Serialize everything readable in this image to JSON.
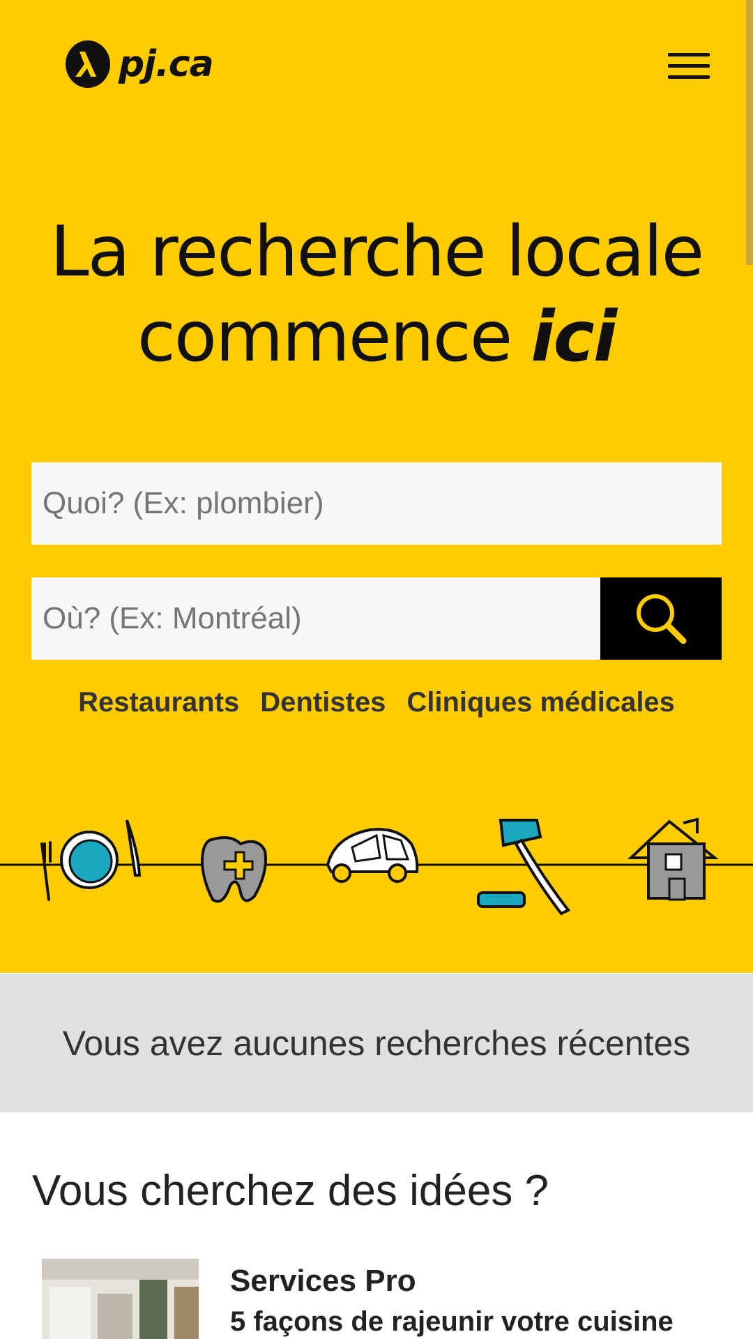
{
  "header": {
    "logo_text": "pj.ca"
  },
  "hero": {
    "headline_line1": "La recherche locale",
    "headline_line2": "commence",
    "headline_emphasis": "ici"
  },
  "search": {
    "what_placeholder": "Quoi? (Ex: plombier)",
    "where_placeholder": "Où? (Ex: Montréal)"
  },
  "quick_links": [
    "Restaurants",
    "Dentistes",
    "Cliniques médicales"
  ],
  "recent": {
    "text": "Vous avez aucunes recherches récentes"
  },
  "ideas": {
    "title": "Vous cherchez des idées ?",
    "card": {
      "category": "Services Pro",
      "title": "5 façons de rajeunir votre cuisine"
    }
  },
  "colors": {
    "brand_yellow": "#ffcc00",
    "accent_teal": "#1aa7c0",
    "dark": "#111111"
  },
  "icons": [
    "pj-logo-icon",
    "menu-icon",
    "search-icon",
    "restaurant-icon",
    "dentist-icon",
    "car-icon",
    "lawyer-icon",
    "house-icon"
  ]
}
